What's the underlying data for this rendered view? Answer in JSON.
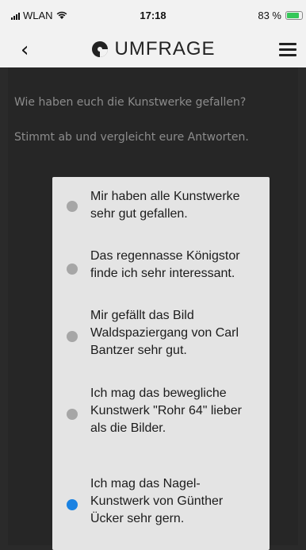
{
  "status_bar": {
    "carrier": "WLAN",
    "time": "17:18",
    "battery_percent": "83 %",
    "battery_level": 0.83,
    "battery_color": "#35c759"
  },
  "nav": {
    "back_icon": "chevron-left-icon",
    "title": "UMFRAGE",
    "logo_icon": "brand-logo-icon",
    "menu_icon": "hamburger-menu-icon"
  },
  "survey": {
    "question": "Wie haben euch die Kunstwerke gefallen?",
    "instruction": "Stimmt ab und vergleicht eure Antworten.",
    "options": [
      {
        "text": "Mir haben alle Kunstwerke sehr gut gefallen.",
        "selected": false
      },
      {
        "text": "Das regennasse Königstor finde ich sehr interessant.",
        "selected": false
      },
      {
        "text": "Mir gefällt das Bild Waldspaziergang von Carl Bantzer sehr gut.",
        "selected": false
      },
      {
        "text": "Ich mag das bewegliche Kunstwerk \"Rohr 64\" lieber als die Bilder.",
        "selected": false
      },
      {
        "text": "Ich mag das Nagel-Kunstwerk von Günther Ücker sehr gern.",
        "selected": true
      }
    ]
  },
  "colors": {
    "background": "#262626",
    "card": "#e4e4e4",
    "radio_unselected": "#a6a6a6",
    "radio_selected": "#1a82e2"
  }
}
